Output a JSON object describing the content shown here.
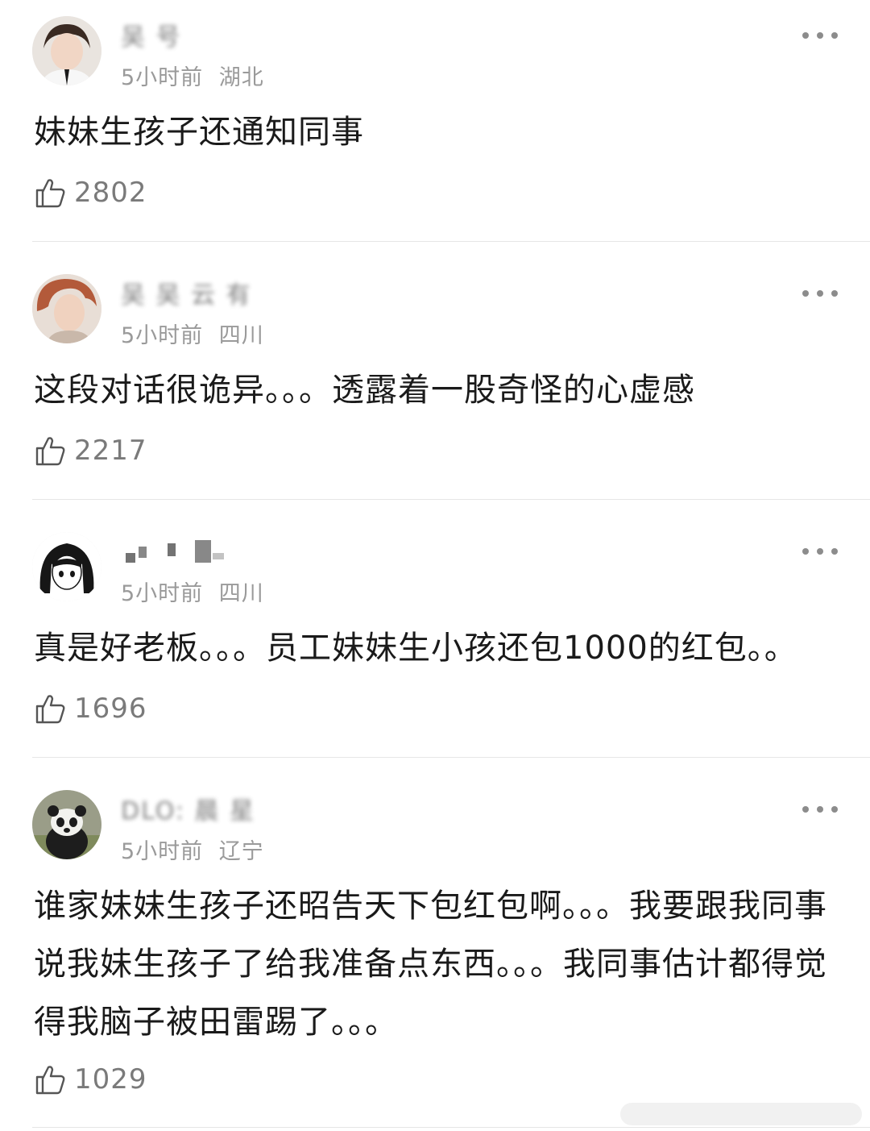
{
  "comments": [
    {
      "username": "吴 号",
      "time": "5小时前",
      "location": "湖北",
      "content": "妹妹生孩子还通知同事",
      "likes": "2802",
      "avatar": "avatar-boy-photo"
    },
    {
      "username": "吴 吴 云 有",
      "time": "5小时前",
      "location": "四川",
      "content": "这段对话很诡异。。。透露着一股奇怪的心虚感",
      "likes": "2217",
      "avatar": "avatar-curly-hair-photo"
    },
    {
      "username": "",
      "time": "5小时前",
      "location": "四川",
      "content": "真是好老板。。。员工妹妹生小孩还包1000的红包。。",
      "likes": "1696",
      "avatar": "avatar-manga-girl"
    },
    {
      "username": "DLO: 晨 星",
      "time": "5小时前",
      "location": "辽宁",
      "content": "谁家妹妹生孩子还昭告天下包红包啊。。。我要跟我同事说我妹生孩子了给我准备点东西。。。我同事估计都得觉得我脑子被田雷踢了。。。",
      "likes": "1029",
      "avatar": "avatar-panda-photo"
    }
  ],
  "icons": {
    "like": "thumbs-up-icon",
    "more": "more-dots-icon"
  },
  "colors": {
    "text": "#1a1a1a",
    "meta": "#9a9a9a",
    "count": "#7a7a7a",
    "divider": "#e6e6e6"
  }
}
